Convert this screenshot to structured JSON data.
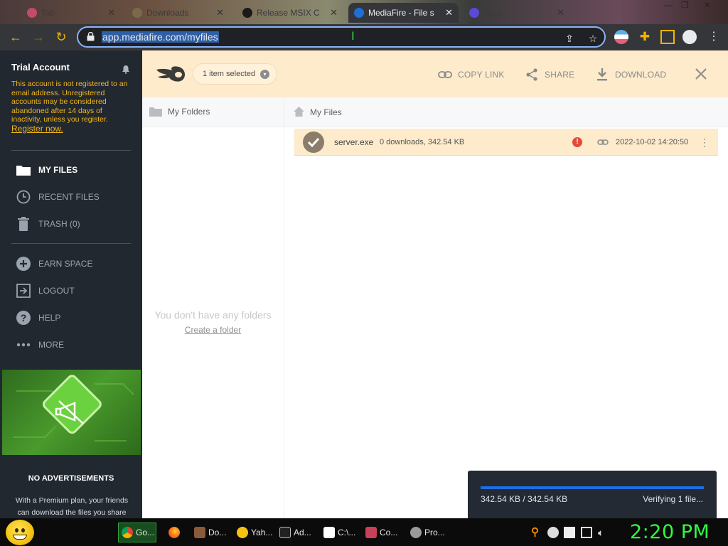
{
  "browser": {
    "tabs": [
      {
        "label": "Tab"
      },
      {
        "label": "Downloads"
      },
      {
        "label": "Release MSIX C"
      },
      {
        "label": "MediaFire - File s"
      },
      {
        "label": "file.io"
      }
    ],
    "url": "app.mediafire.com/myfiles"
  },
  "sidebar": {
    "account_title": "Trial Account",
    "warning": "This account is not registered to an email address. Unregistered accounts may be considered abandoned after 14 days of inactivity, unless you register.",
    "register_link": "Register now.",
    "nav": [
      {
        "label": "MY FILES",
        "icon": "folder-icon"
      },
      {
        "label": "RECENT FILES",
        "icon": "clock-icon"
      },
      {
        "label": "TRASH (0)",
        "icon": "trash-icon"
      },
      {
        "label": "EARN SPACE",
        "icon": "plus-circle-icon"
      },
      {
        "label": "LOGOUT",
        "icon": "logout-icon"
      },
      {
        "label": "HELP",
        "icon": "help-icon"
      },
      {
        "label": "MORE",
        "icon": "more-icon"
      }
    ],
    "promo_title": "NO ADVERTISEMENTS",
    "promo_text": "With a Premium plan, your friends can download the files you share"
  },
  "header": {
    "selection": "1 item selected",
    "actions": {
      "copy_link": "COPY LINK",
      "share": "SHARE",
      "download": "DOWNLOAD"
    }
  },
  "folders": {
    "title": "My Folders",
    "empty_text": "You don't have any folders",
    "create_link": "Create a folder"
  },
  "files": {
    "title": "My Files",
    "rows": [
      {
        "name": "server.exe",
        "meta": "0 downloads, 342.54 KB",
        "date": "2022-10-02 14:20:50"
      }
    ]
  },
  "upload": {
    "size_text": "342.54 KB / 342.54 KB",
    "status": "Verifying 1 file...",
    "progress": 1.0
  },
  "taskbar": {
    "tasks": [
      {
        "label": "Go...",
        "icon": "chrome-icon"
      },
      {
        "label": "",
        "icon": "firefox-icon"
      },
      {
        "label": "Do...",
        "icon": "document-icon"
      },
      {
        "label": "Yah...",
        "icon": "yahoo-messenger-icon"
      },
      {
        "label": "Ad...",
        "icon": "cmd-icon"
      },
      {
        "label": "C:\\...",
        "icon": "7zip-icon"
      },
      {
        "label": "Co...",
        "icon": "control-panel-icon"
      },
      {
        "label": "Pro...",
        "icon": "process-icon"
      }
    ],
    "clock": "2:20 PM"
  },
  "colors": {
    "accent_orange": "#fdebcc",
    "sidebar": "#222830",
    "progress": "#1c6ee3",
    "clock": "#2cff3f"
  }
}
